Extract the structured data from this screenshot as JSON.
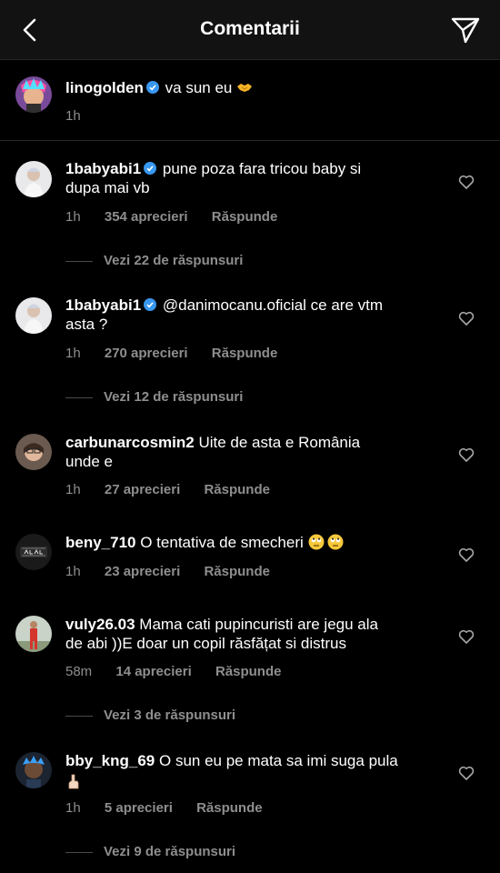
{
  "header": {
    "title": "Comentarii"
  },
  "caption": {
    "username": "linogolden",
    "text": "va sun eu",
    "time": "1h"
  },
  "comments": [
    {
      "username": "1babyabi1",
      "verified": true,
      "text_line1": "pune poza fara tricou baby si",
      "text_line2": "dupa mai vb",
      "time": "1h",
      "likes": "354 aprecieri",
      "reply": "Răspunde",
      "view_replies": "Vezi 22 de răspunsuri"
    },
    {
      "username": "1babyabi1",
      "verified": true,
      "text_line1": "@danimocanu.oficial ce are vtm",
      "text_line2": "asta ?",
      "time": "1h",
      "likes": "270 aprecieri",
      "reply": "Răspunde",
      "view_replies": "Vezi 12 de răspunsuri"
    },
    {
      "username": "carbunarcosmin2",
      "text_line1": "Uite de asta e  România",
      "text_line2": "unde e",
      "time": "1h",
      "likes": "27 aprecieri",
      "reply": "Răspunde"
    },
    {
      "username": "beny_710",
      "text_line1": "O tentativa de smecheri",
      "time": "1h",
      "likes": "23 aprecieri",
      "reply": "Răspunde"
    },
    {
      "username": "vuly26.03",
      "text_line1": "Mama cati pupincuristi are jegu ala",
      "text_line2": "de abi ))E doar un copil răsfățat si distrus",
      "time": "58m",
      "likes": "14 aprecieri",
      "reply": "Răspunde",
      "view_replies": "Vezi 3 de răspunsuri"
    },
    {
      "username": "bby_kng_69",
      "text_line1": "O sun eu pe mata sa imi suga pula",
      "time": "1h",
      "likes": "5 aprecieri",
      "reply": "Răspunde",
      "view_replies": "Vezi 9 de răspunsuri"
    }
  ],
  "icons": {
    "back": "chevron-left-icon",
    "send": "send-icon",
    "verified": "verified-badge-icon",
    "heart": "heart-outline-icon"
  },
  "colors": {
    "background": "#000000",
    "header": "#121212",
    "secondary_text": "#8e8e8e",
    "verified": "#3897f0"
  }
}
